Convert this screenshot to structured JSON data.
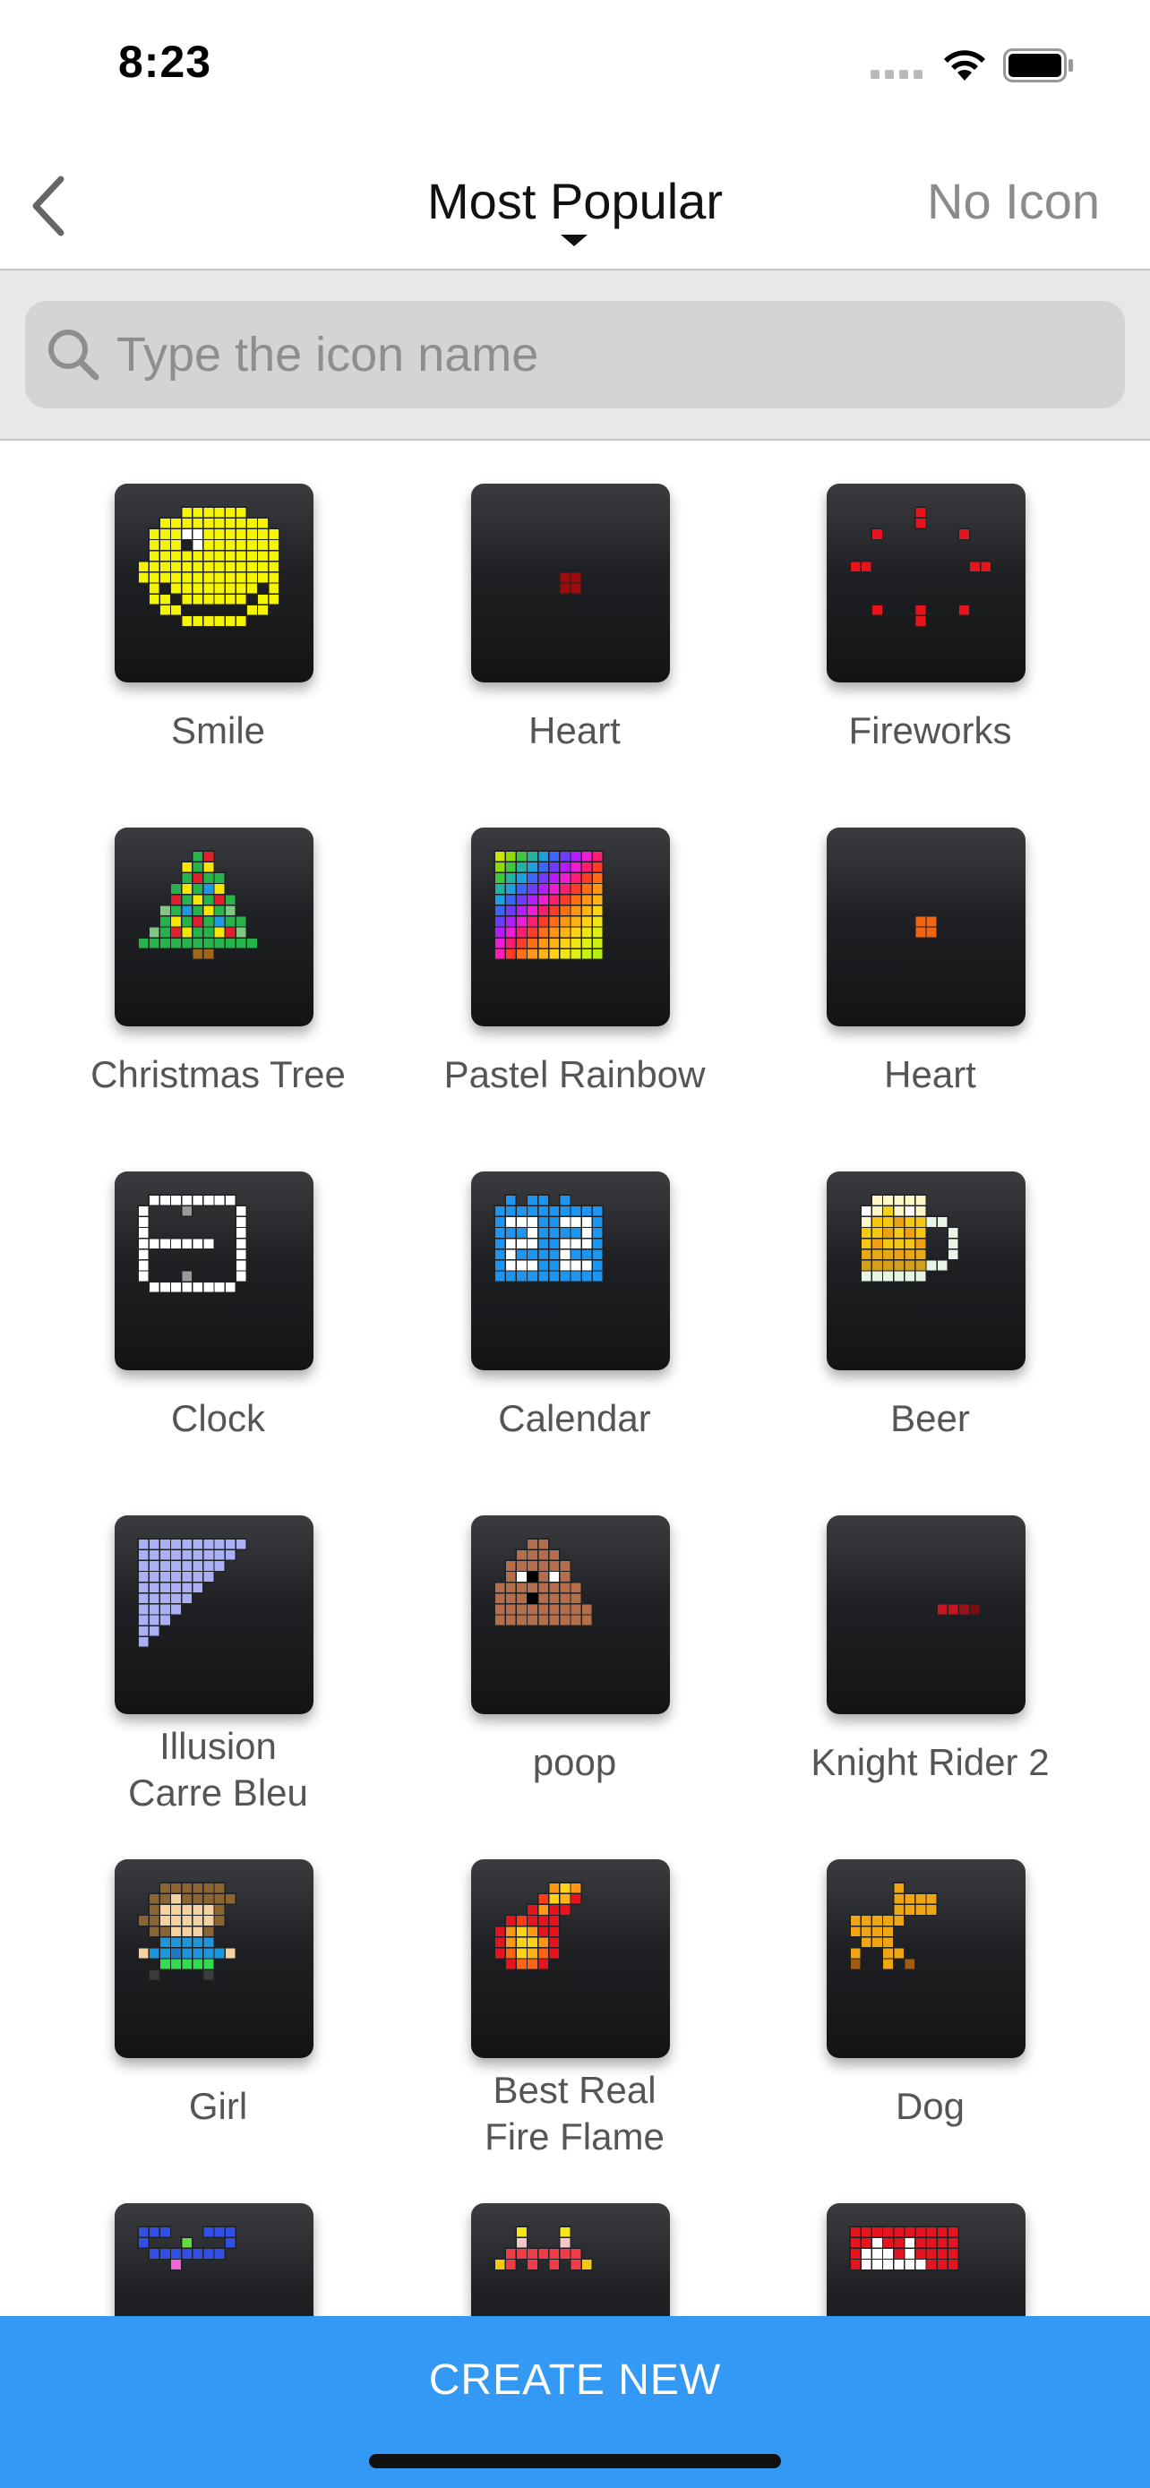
{
  "status_bar": {
    "time": "8:23"
  },
  "nav": {
    "title": "Most Popular",
    "right_button": "No Icon"
  },
  "search": {
    "placeholder": "Type the icon name"
  },
  "icons": [
    {
      "label": "Smile"
    },
    {
      "label": "Heart"
    },
    {
      "label": "Fireworks"
    },
    {
      "label": "Christmas Tree"
    },
    {
      "label": "Pastel Rainbow"
    },
    {
      "label": "Heart"
    },
    {
      "label": "Clock"
    },
    {
      "label": "Calendar"
    },
    {
      "label": "Beer"
    },
    {
      "label": "Illusion\nCarre Bleu"
    },
    {
      "label": "poop"
    },
    {
      "label": "Knight Rider 2"
    },
    {
      "label": "Girl"
    },
    {
      "label": "Best Real\nFire Flame"
    },
    {
      "label": "Dog"
    },
    {
      "label": ""
    },
    {
      "label": ""
    },
    {
      "label": ""
    }
  ],
  "create_button": {
    "label": "CREATE NEW"
  },
  "colors": {
    "accent": "#3399f5",
    "tile": "#1e2023"
  }
}
